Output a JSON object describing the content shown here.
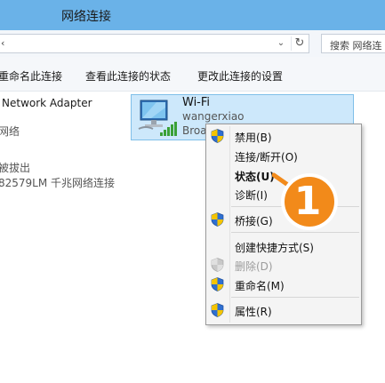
{
  "window": {
    "title": "网络连接"
  },
  "address": {
    "first_chevron": "‹",
    "dropdown_glyph": "⌄",
    "refresh_glyph": "↻"
  },
  "search": {
    "placeholder": "搜索 网络连"
  },
  "toolbar": {
    "rename": "重命名此连接",
    "view_status": "查看此连接的状态",
    "change_settings": "更改此连接的设置"
  },
  "adapters": {
    "left": {
      "name": "Network Adapter",
      "type": "网络",
      "status": "被拔出",
      "device": "82579LM 千兆网络连接"
    },
    "wifi": {
      "name": "Wi-Fi",
      "ssid": "wangerxiao",
      "device": "Broa"
    }
  },
  "context_menu": {
    "items": [
      {
        "label": "禁用(B)",
        "shield": true
      },
      {
        "label": "连接/断开(O)",
        "shield": false
      },
      {
        "label": "状态(U)",
        "shield": false,
        "bold": true
      },
      {
        "label": "诊断(I)",
        "shield": false
      },
      {
        "label": "桥接(G)",
        "shield": true
      },
      {
        "label": "创建快捷方式(S)",
        "shield": false
      },
      {
        "label": "删除(D)",
        "shield": true,
        "disabled": true
      },
      {
        "label": "重命名(M)",
        "shield": true
      },
      {
        "label": "属性(R)",
        "shield": true
      }
    ]
  },
  "callout": {
    "number": "1"
  },
  "colors": {
    "titlebar": "#6ab2e8",
    "selection": "#cde8fb",
    "badge": "#f28a1a",
    "signal": "#3aa035"
  }
}
